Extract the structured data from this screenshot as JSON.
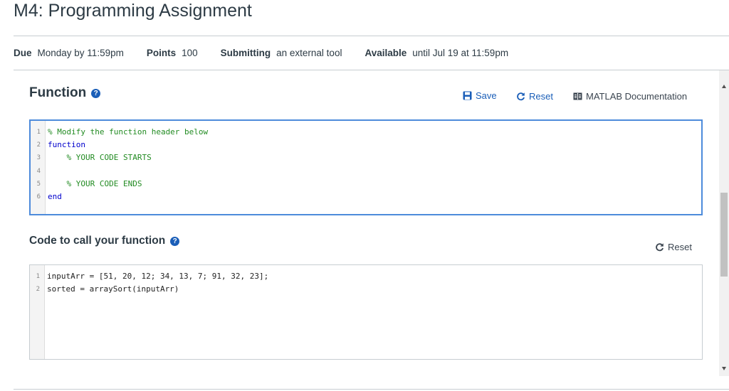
{
  "page": {
    "title": "M4: Programming Assignment"
  },
  "details": {
    "due_label": "Due",
    "due_value": "Monday by 11:59pm",
    "points_label": "Points",
    "points_value": "100",
    "submitting_label": "Submitting",
    "submitting_value": "an external tool",
    "available_label": "Available",
    "available_value": "until Jul 19 at 11:59pm"
  },
  "function_section": {
    "title": "Function",
    "help_icon": "question-circle-icon",
    "toolbar": {
      "save_label": "Save",
      "reset_label": "Reset",
      "docs_label": "MATLAB Documentation"
    },
    "code_lines": [
      {
        "num": "1",
        "text": "% Modify the function header below"
      },
      {
        "num": "2",
        "text": "function"
      },
      {
        "num": "3",
        "text": "    % YOUR CODE STARTS"
      },
      {
        "num": "4",
        "text": ""
      },
      {
        "num": "5",
        "text": "    % YOUR CODE ENDS"
      },
      {
        "num": "6",
        "text": "end"
      }
    ]
  },
  "call_section": {
    "title": "Code to call your function",
    "help_icon": "question-circle-icon",
    "reset_label": "Reset",
    "code_lines": [
      {
        "num": "1",
        "text": "inputArr = [51, 20, 12; 34, 13, 7; 91, 32, 23];"
      },
      {
        "num": "2",
        "text": "sorted = arraySort(inputArr)"
      }
    ]
  },
  "colors": {
    "accent": "#1a5eb8",
    "comment": "#228b22",
    "keyword": "#0000cc",
    "editor_focus_border": "#4d8bdb"
  }
}
